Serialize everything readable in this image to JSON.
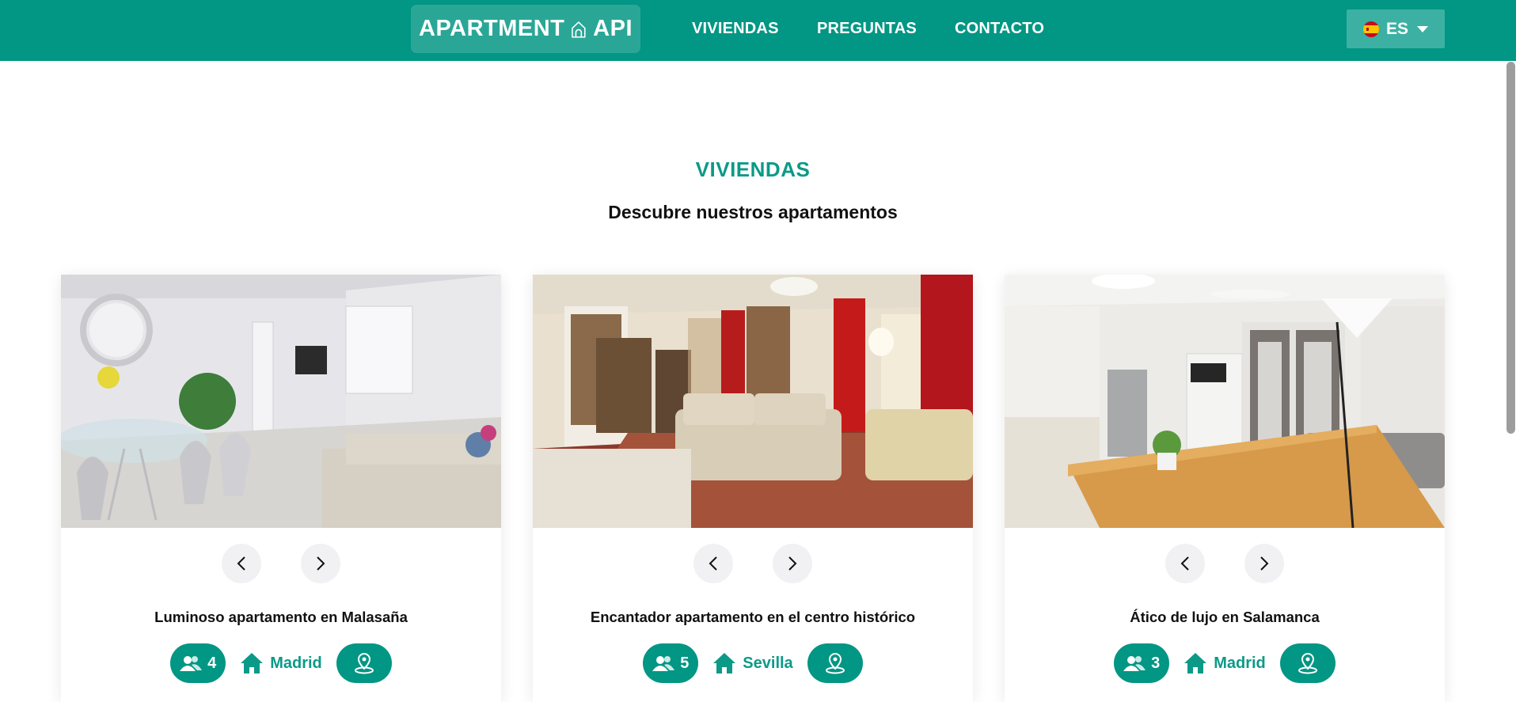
{
  "header": {
    "logo_left": "APARTMENT",
    "logo_right": "API",
    "nav": [
      "VIVIENDAS",
      "PREGUNTAS",
      "CONTACTO"
    ],
    "language": "ES",
    "brand_color": "#029684"
  },
  "section": {
    "eyebrow": "VIVIENDAS",
    "title": "Descubre nuestros apartamentos"
  },
  "cards": [
    {
      "title": "Luminoso apartamento en Malasaña",
      "guests": "4",
      "city": "Madrid"
    },
    {
      "title": "Encantador apartamento en el centro histórico",
      "guests": "5",
      "city": "Sevilla"
    },
    {
      "title": "Ático de lujo en Salamanca",
      "guests": "3",
      "city": "Madrid"
    }
  ],
  "icons": {
    "guests": "users-icon",
    "city": "home-icon",
    "map": "map-pin-icon",
    "prev": "chevron-left-icon",
    "next": "chevron-right-icon"
  }
}
